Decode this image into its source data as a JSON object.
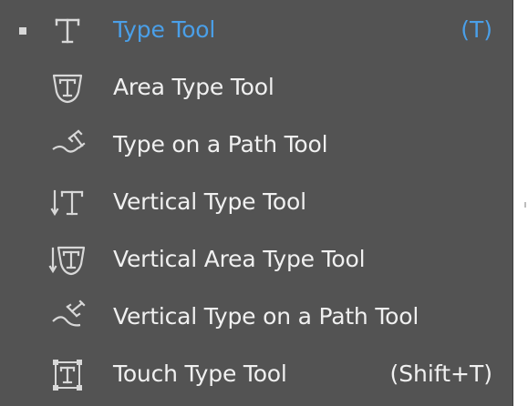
{
  "menu": {
    "items": [
      {
        "label": "Type Tool",
        "shortcut": "(T)",
        "icon": "type-tool-icon",
        "active": true
      },
      {
        "label": "Area Type Tool",
        "shortcut": "",
        "icon": "area-type-tool-icon",
        "active": false
      },
      {
        "label": "Type on a Path Tool",
        "shortcut": "",
        "icon": "type-on-path-tool-icon",
        "active": false
      },
      {
        "label": "Vertical Type Tool",
        "shortcut": "",
        "icon": "vertical-type-tool-icon",
        "active": false
      },
      {
        "label": "Vertical Area Type Tool",
        "shortcut": "",
        "icon": "vertical-area-type-tool-icon",
        "active": false
      },
      {
        "label": "Vertical Type on a Path Tool",
        "shortcut": "",
        "icon": "vertical-type-on-path-tool-icon",
        "active": false
      },
      {
        "label": "Touch Type Tool",
        "shortcut": "(Shift+T)",
        "icon": "touch-type-tool-icon",
        "active": false
      }
    ]
  },
  "colors": {
    "background": "#535353",
    "text": "#f0f0f0",
    "active_text": "#4a9fe8"
  }
}
